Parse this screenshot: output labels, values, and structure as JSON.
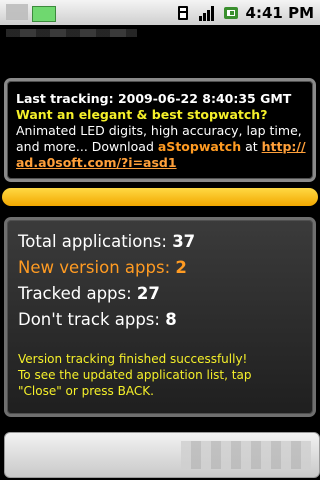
{
  "status_bar": {
    "time": "4:41 PM",
    "icons": [
      "sd-card-icon",
      "signal-icon",
      "battery-icon"
    ]
  },
  "info": {
    "last_tracking": "Last tracking: 2009-06-22 8:40:35 GMT",
    "promo_title": "Want an elegant & best stopwatch?",
    "promo_line1": "Animated LED digits, high accuracy, lap time,",
    "promo_line2_prefix": "and more... Download ",
    "promo_app": "aStopwatch",
    "promo_at": " at ",
    "promo_link1": "http://",
    "promo_link2": "ad.a0soft.com/?i=asd1"
  },
  "progress": {
    "value": 1.0,
    "color": "#f2b400"
  },
  "stats": {
    "total_label": "Total applications: ",
    "total_value": "37",
    "new_label": "New version apps: ",
    "new_value": "2",
    "tracked_label": "Tracked apps: ",
    "tracked_value": "27",
    "untracked_label": "Don't track apps: ",
    "untracked_value": "8"
  },
  "message": {
    "line1": "Version tracking finished successfully!",
    "line2": "To see the updated application list, tap",
    "line3": "\"Close\" or press BACK."
  },
  "colors": {
    "accent_orange": "#ff9b22",
    "message_yellow": "#f5f02a"
  }
}
